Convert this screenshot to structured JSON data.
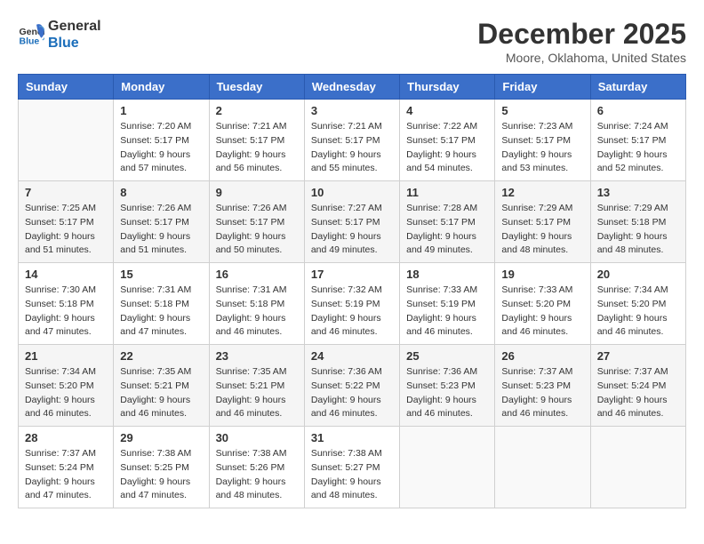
{
  "logo": {
    "line1": "General",
    "line2": "Blue"
  },
  "title": "December 2025",
  "location": "Moore, Oklahoma, United States",
  "weekdays": [
    "Sunday",
    "Monday",
    "Tuesday",
    "Wednesday",
    "Thursday",
    "Friday",
    "Saturday"
  ],
  "weeks": [
    [
      {
        "day": "",
        "info": ""
      },
      {
        "day": "1",
        "info": "Sunrise: 7:20 AM\nSunset: 5:17 PM\nDaylight: 9 hours\nand 57 minutes."
      },
      {
        "day": "2",
        "info": "Sunrise: 7:21 AM\nSunset: 5:17 PM\nDaylight: 9 hours\nand 56 minutes."
      },
      {
        "day": "3",
        "info": "Sunrise: 7:21 AM\nSunset: 5:17 PM\nDaylight: 9 hours\nand 55 minutes."
      },
      {
        "day": "4",
        "info": "Sunrise: 7:22 AM\nSunset: 5:17 PM\nDaylight: 9 hours\nand 54 minutes."
      },
      {
        "day": "5",
        "info": "Sunrise: 7:23 AM\nSunset: 5:17 PM\nDaylight: 9 hours\nand 53 minutes."
      },
      {
        "day": "6",
        "info": "Sunrise: 7:24 AM\nSunset: 5:17 PM\nDaylight: 9 hours\nand 52 minutes."
      }
    ],
    [
      {
        "day": "7",
        "info": "Sunrise: 7:25 AM\nSunset: 5:17 PM\nDaylight: 9 hours\nand 51 minutes."
      },
      {
        "day": "8",
        "info": "Sunrise: 7:26 AM\nSunset: 5:17 PM\nDaylight: 9 hours\nand 51 minutes."
      },
      {
        "day": "9",
        "info": "Sunrise: 7:26 AM\nSunset: 5:17 PM\nDaylight: 9 hours\nand 50 minutes."
      },
      {
        "day": "10",
        "info": "Sunrise: 7:27 AM\nSunset: 5:17 PM\nDaylight: 9 hours\nand 49 minutes."
      },
      {
        "day": "11",
        "info": "Sunrise: 7:28 AM\nSunset: 5:17 PM\nDaylight: 9 hours\nand 49 minutes."
      },
      {
        "day": "12",
        "info": "Sunrise: 7:29 AM\nSunset: 5:17 PM\nDaylight: 9 hours\nand 48 minutes."
      },
      {
        "day": "13",
        "info": "Sunrise: 7:29 AM\nSunset: 5:18 PM\nDaylight: 9 hours\nand 48 minutes."
      }
    ],
    [
      {
        "day": "14",
        "info": "Sunrise: 7:30 AM\nSunset: 5:18 PM\nDaylight: 9 hours\nand 47 minutes."
      },
      {
        "day": "15",
        "info": "Sunrise: 7:31 AM\nSunset: 5:18 PM\nDaylight: 9 hours\nand 47 minutes."
      },
      {
        "day": "16",
        "info": "Sunrise: 7:31 AM\nSunset: 5:18 PM\nDaylight: 9 hours\nand 46 minutes."
      },
      {
        "day": "17",
        "info": "Sunrise: 7:32 AM\nSunset: 5:19 PM\nDaylight: 9 hours\nand 46 minutes."
      },
      {
        "day": "18",
        "info": "Sunrise: 7:33 AM\nSunset: 5:19 PM\nDaylight: 9 hours\nand 46 minutes."
      },
      {
        "day": "19",
        "info": "Sunrise: 7:33 AM\nSunset: 5:20 PM\nDaylight: 9 hours\nand 46 minutes."
      },
      {
        "day": "20",
        "info": "Sunrise: 7:34 AM\nSunset: 5:20 PM\nDaylight: 9 hours\nand 46 minutes."
      }
    ],
    [
      {
        "day": "21",
        "info": "Sunrise: 7:34 AM\nSunset: 5:20 PM\nDaylight: 9 hours\nand 46 minutes."
      },
      {
        "day": "22",
        "info": "Sunrise: 7:35 AM\nSunset: 5:21 PM\nDaylight: 9 hours\nand 46 minutes."
      },
      {
        "day": "23",
        "info": "Sunrise: 7:35 AM\nSunset: 5:21 PM\nDaylight: 9 hours\nand 46 minutes."
      },
      {
        "day": "24",
        "info": "Sunrise: 7:36 AM\nSunset: 5:22 PM\nDaylight: 9 hours\nand 46 minutes."
      },
      {
        "day": "25",
        "info": "Sunrise: 7:36 AM\nSunset: 5:23 PM\nDaylight: 9 hours\nand 46 minutes."
      },
      {
        "day": "26",
        "info": "Sunrise: 7:37 AM\nSunset: 5:23 PM\nDaylight: 9 hours\nand 46 minutes."
      },
      {
        "day": "27",
        "info": "Sunrise: 7:37 AM\nSunset: 5:24 PM\nDaylight: 9 hours\nand 46 minutes."
      }
    ],
    [
      {
        "day": "28",
        "info": "Sunrise: 7:37 AM\nSunset: 5:24 PM\nDaylight: 9 hours\nand 47 minutes."
      },
      {
        "day": "29",
        "info": "Sunrise: 7:38 AM\nSunset: 5:25 PM\nDaylight: 9 hours\nand 47 minutes."
      },
      {
        "day": "30",
        "info": "Sunrise: 7:38 AM\nSunset: 5:26 PM\nDaylight: 9 hours\nand 48 minutes."
      },
      {
        "day": "31",
        "info": "Sunrise: 7:38 AM\nSunset: 5:27 PM\nDaylight: 9 hours\nand 48 minutes."
      },
      {
        "day": "",
        "info": ""
      },
      {
        "day": "",
        "info": ""
      },
      {
        "day": "",
        "info": ""
      }
    ]
  ]
}
